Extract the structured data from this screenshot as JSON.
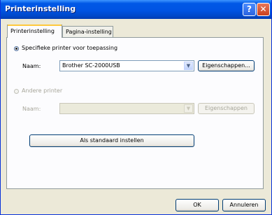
{
  "window": {
    "title": "Printerinstelling",
    "help_glyph": "?",
    "close_glyph": "✕"
  },
  "tabs": [
    {
      "label": "Printerinstelling",
      "selected": true
    },
    {
      "label": "Pagina-instelling",
      "selected": false
    }
  ],
  "option_specific": {
    "label": "Specifieke printer voor toepassing",
    "checked": true,
    "name_label": "Naam:",
    "printer_value": "Brother SC-2000USB",
    "properties_label": "Eigenschappen..."
  },
  "option_other": {
    "label": "Andere printer",
    "checked": false,
    "enabled": false,
    "name_label": "Naam:",
    "printer_value": "",
    "properties_label": "Eigenschappen"
  },
  "set_default_label": "Als standaard instellen",
  "footer": {
    "ok_label": "OK",
    "cancel_label": "Annuleren"
  },
  "colors": {
    "titlebar": "#0054e3",
    "dialog_bg": "#ece9d8",
    "disabled_text": "#a7a69a"
  }
}
